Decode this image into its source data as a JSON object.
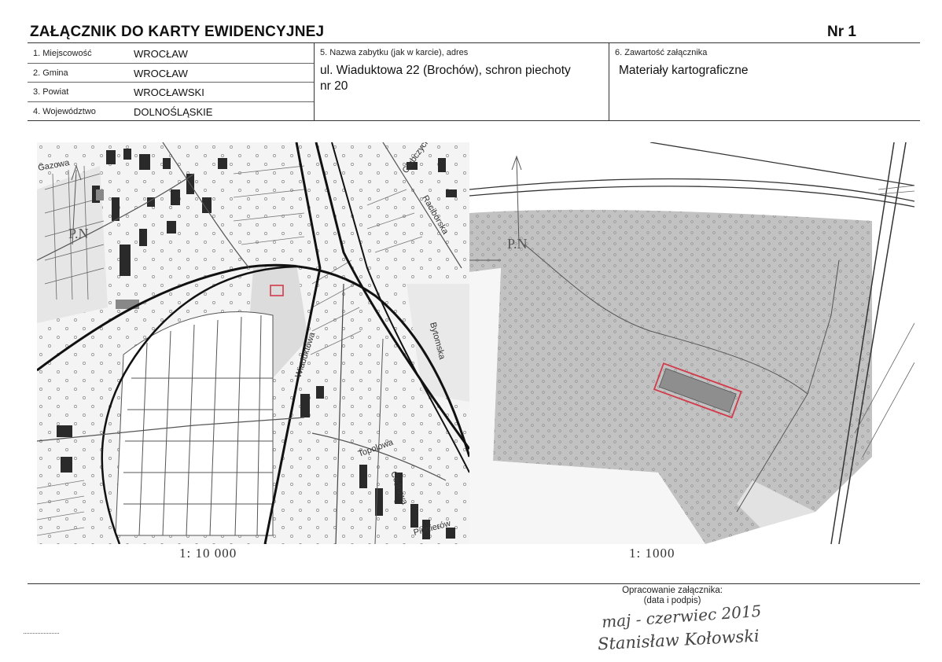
{
  "header": {
    "title": "ZAŁĄCZNIK DO KARTY EWIDENCYJNEJ",
    "number": "Nr 1"
  },
  "fields": {
    "left": [
      {
        "label": "1. Miejscowość",
        "value": "WROCŁAW"
      },
      {
        "label": "2. Gmina",
        "value": "WROCŁAW"
      },
      {
        "label": "3. Powiat",
        "value": "WROCŁAWSKI"
      },
      {
        "label": "4. Województwo",
        "value": "DOLNOŚLĄSKIE"
      }
    ],
    "monument": {
      "label": "5. Nazwa zabytku (jak w karcie), adres",
      "value_line1": "ul. Wiaduktowa 22 (Brochów), schron piechoty",
      "value_line2": "nr 20"
    },
    "contents": {
      "label": "6. Zawartość załącznika",
      "value": "Materiały kartograficzne"
    }
  },
  "maps": {
    "left": {
      "scale": "1: 10 000",
      "streets": [
        "Gazowa",
        "Głubczycka",
        "Raciborska",
        "Bytomska",
        "Wiaduktowa",
        "Topolowa",
        "Cedrowa",
        "Pionierów"
      ],
      "marker": "P.N"
    },
    "right": {
      "scale": "1: 1000",
      "marker": "P.N"
    }
  },
  "footer": {
    "prepared_label": "Opracowanie załącznika:",
    "prepared_sub": "(data i podpis)",
    "date_handwritten": "maj - czerwiec 2015",
    "signature_handwritten": "Stanisław Kołowski"
  },
  "colors": {
    "marker": "#d23a4a",
    "map_gray": "#bdbdbd",
    "building": "#2a2a2a"
  }
}
